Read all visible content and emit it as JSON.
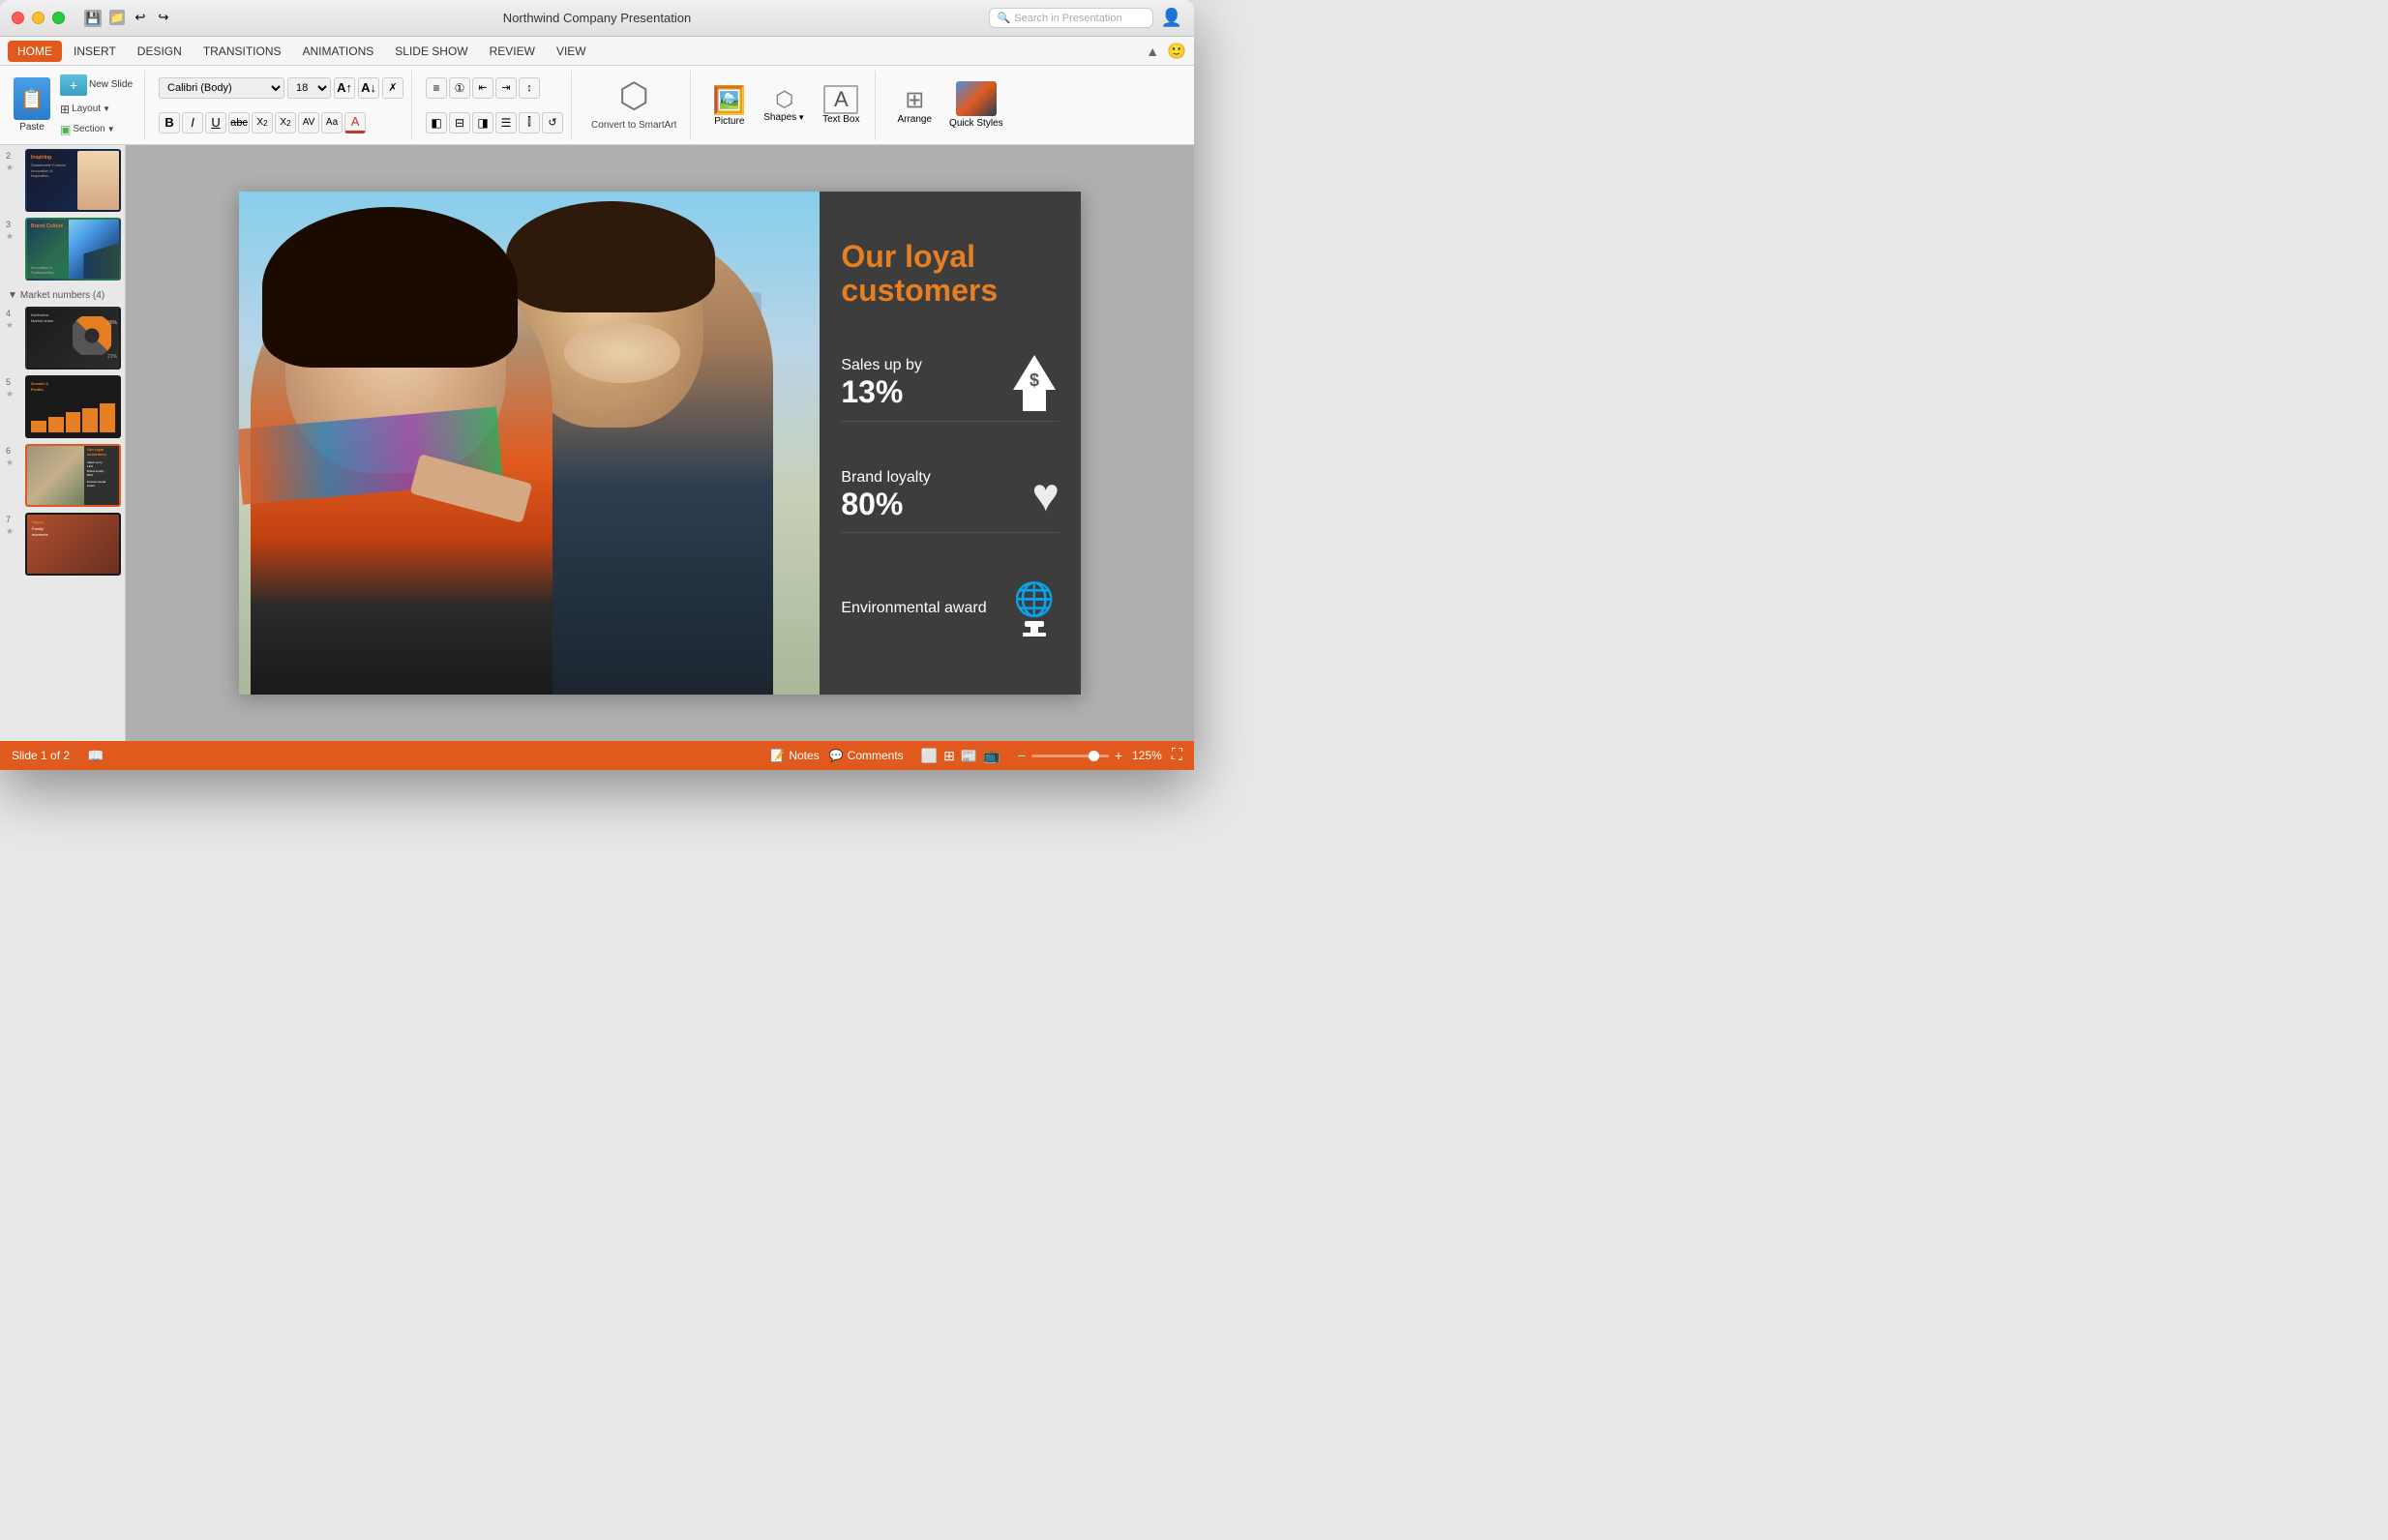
{
  "window": {
    "title": "Northwind Company Presentation"
  },
  "titlebar": {
    "search_placeholder": "Search in Presentation",
    "icons": [
      "save-icon",
      "folder-icon",
      "undo-icon",
      "redo-icon"
    ]
  },
  "menubar": {
    "items": [
      {
        "id": "home",
        "label": "HOME",
        "active": true
      },
      {
        "id": "insert",
        "label": "INSERT",
        "active": false
      },
      {
        "id": "design",
        "label": "DESIGN",
        "active": false
      },
      {
        "id": "transitions",
        "label": "TRANSITIONS",
        "active": false
      },
      {
        "id": "animations",
        "label": "ANIMATIONS",
        "active": false
      },
      {
        "id": "slideshow",
        "label": "SLIDE SHOW",
        "active": false
      },
      {
        "id": "review",
        "label": "REVIEW",
        "active": false
      },
      {
        "id": "view",
        "label": "VIEW",
        "active": false
      }
    ]
  },
  "ribbon": {
    "paste_label": "Paste",
    "new_slide_label": "New Slide",
    "layout_label": "Layout",
    "section_label": "Section",
    "font_family": "Calibri (Body)",
    "font_size": "18",
    "bold_label": "B",
    "italic_label": "I",
    "underline_label": "U",
    "strikethrough_label": "abc",
    "superscript_label": "X²",
    "subscript_label": "X₂",
    "convert_smartart_label": "Convert to SmartArt",
    "picture_label": "Picture",
    "textbox_label": "Text Box",
    "shapes_label": "Shapes",
    "arrange_label": "Arrange",
    "quick_styles_label": "Quick Styles"
  },
  "slides": {
    "items": [
      {
        "num": "2",
        "type": "dark-blue"
      },
      {
        "num": "3",
        "type": "solar"
      },
      {
        "section": "Market numbers (4)",
        "collapsed": false
      },
      {
        "num": "4",
        "type": "chart"
      },
      {
        "num": "5",
        "type": "bar"
      },
      {
        "num": "6",
        "type": "customers",
        "active": true
      },
      {
        "num": "7",
        "type": "family"
      }
    ]
  },
  "slide": {
    "title": "Our loyal customers",
    "stat1_label": "Sales up by",
    "stat1_value": "13%",
    "stat2_label": "Brand loyalty",
    "stat2_value": "80%",
    "stat3_label": "Environmental award"
  },
  "statusbar": {
    "slide_info": "Slide 1 of 2",
    "notes_label": "Notes",
    "comments_label": "Comments",
    "zoom_level": "125%"
  }
}
